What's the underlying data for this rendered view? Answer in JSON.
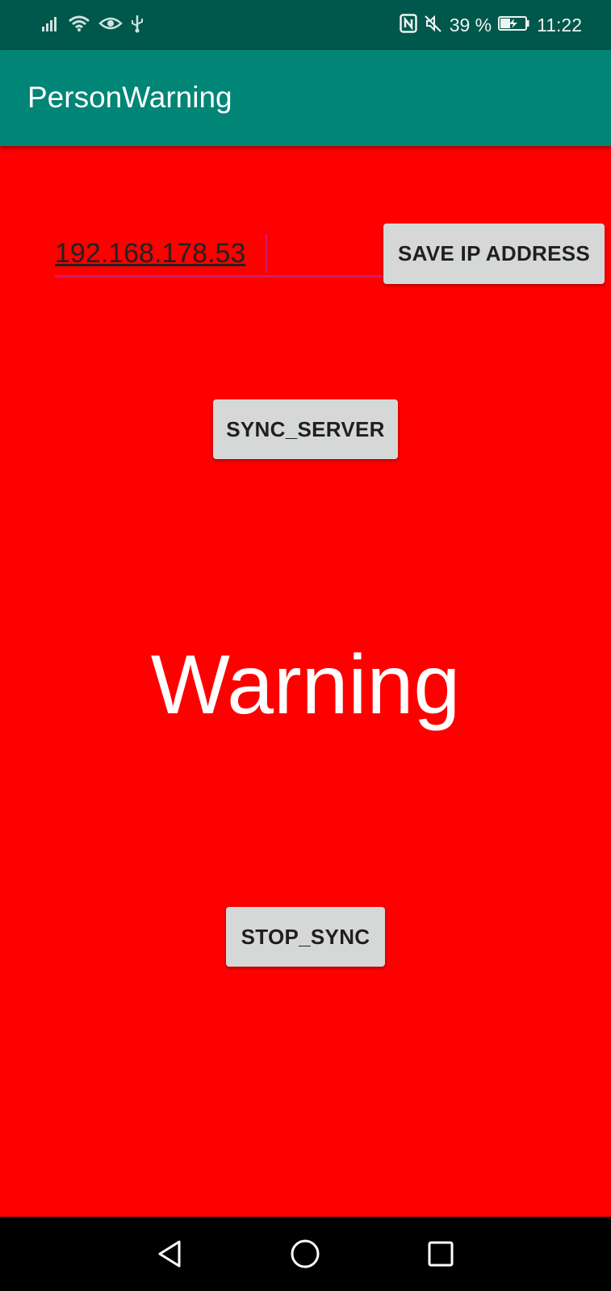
{
  "status_bar": {
    "battery_percent": "39 %",
    "time": "11:22",
    "left_icons": [
      "signal-icon",
      "wifi-icon",
      "eye-icon",
      "usb-icon"
    ],
    "right_icons": [
      "nfc-icon",
      "mute-icon",
      "battery-charging-icon"
    ]
  },
  "app_bar": {
    "title": "PersonWarning",
    "color": "#008577"
  },
  "main": {
    "background_color": "#ff0000",
    "ip_input": {
      "value": "192.168.178.53"
    },
    "save_button_label": "SAVE IP ADDRESS",
    "sync_button_label": "SYNC_SERVER",
    "warning_text": "Warning",
    "stop_button_label": "STOP_SYNC"
  },
  "nav_bar": {
    "icons": [
      "back-icon",
      "home-icon",
      "recents-icon"
    ]
  }
}
